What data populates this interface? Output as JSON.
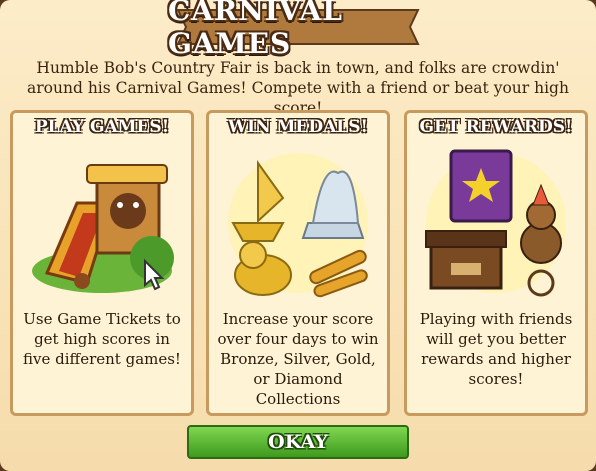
{
  "dialog": {
    "title": "CARNIVAL GAMES",
    "intro": "Humble Bob's Country Fair is back in town, and folks are crowdin' around his Carnival Games! Compete with a friend or beat your high score!"
  },
  "panels": [
    {
      "title": "PLAY GAMES!",
      "description": "Use Game Tickets to get high scores in five different games!",
      "icon": "carnival-slide-icon"
    },
    {
      "title": "WIN MEDALS!",
      "description": "Increase your score over four days to win Bronze, Silver, Gold, or Diamond Collections",
      "icon": "trophies-icon"
    },
    {
      "title": "GET REWARDS!",
      "description": "Playing with friends will get you better rewards and higher scores!",
      "icon": "rewards-icon"
    }
  ],
  "buttons": {
    "okay": "OKAY"
  },
  "colors": {
    "okay_button": "#4caf2a",
    "panel_border": "#c99a5e",
    "title_outline": "#4a2a12"
  }
}
